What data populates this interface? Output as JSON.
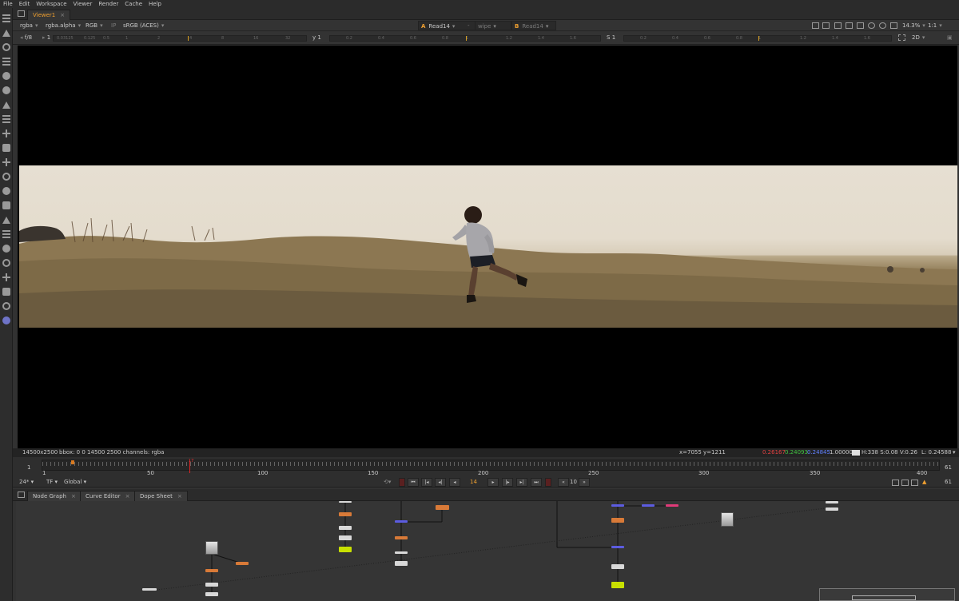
{
  "menu": [
    "File",
    "Edit",
    "Workspace",
    "Viewer",
    "Render",
    "Cache",
    "Help"
  ],
  "viewer_tab": {
    "label": "Viewer1"
  },
  "viewer_controls": {
    "channels": "rgba",
    "alpha": "rgba.alpha",
    "colorspace_rgb": "RGB",
    "ip": "IP",
    "lut": "sRGB (ACES)",
    "input_a_letter": "A",
    "input_a": "Read14",
    "wipe": "wipe",
    "input_b_letter": "B",
    "input_b": "Read14",
    "zoom": "14.3%",
    "ratio": "1:1",
    "fstop": "f/8",
    "frame_val": "1",
    "y_label": "y",
    "y_val": "1",
    "s_label": "S",
    "s_val": "1",
    "view_mode": "2D"
  },
  "status": {
    "resolution": "14500x2500",
    "bbox": "bbox: 0 0 14500 2500 channels: rgba",
    "coords": "x=7055 y=1211",
    "r": "0.26167",
    "g": "0.24093",
    "b": "0.24845",
    "a": "1.00000",
    "hsv": "H:338 S:0.08 V:0.26",
    "lum": "L: 0.24588"
  },
  "timeline": {
    "start": "1",
    "end": "61",
    "labels": [
      "1",
      "50",
      "100",
      "150",
      "200",
      "250",
      "300",
      "350",
      "400"
    ],
    "current_frame_marker": "17"
  },
  "transport": {
    "fps": "24*",
    "tf": "TF",
    "global": "Global",
    "frame": "14",
    "increment": "10",
    "end_frame": "61"
  },
  "graph_tabs": [
    "Node Graph",
    "Curve Editor",
    "Dope Sheet"
  ],
  "colors": {
    "accent": "#f0a030",
    "red_channel": "#e04040",
    "green_channel": "#40c040",
    "blue_channel": "#6080ff",
    "node_orange": "#d87a38",
    "node_blue": "#5c5ce0",
    "node_yellow": "#c8e000",
    "node_pink": "#e03a78"
  },
  "icons": [
    "viewer-pane-icon",
    "transform-icon",
    "clock-icon",
    "channel-icon",
    "color-icon",
    "filter-icon",
    "keyer-icon",
    "merge-icon",
    "layers-icon",
    "move-icon",
    "3d-icon",
    "particles-icon",
    "deep-icon",
    "view-icon",
    "metadata-icon",
    "toolsets-icon",
    "other-icon",
    "furnace-icon",
    "cara-vr-icon",
    "ocula-icon",
    "nuke-icon"
  ]
}
